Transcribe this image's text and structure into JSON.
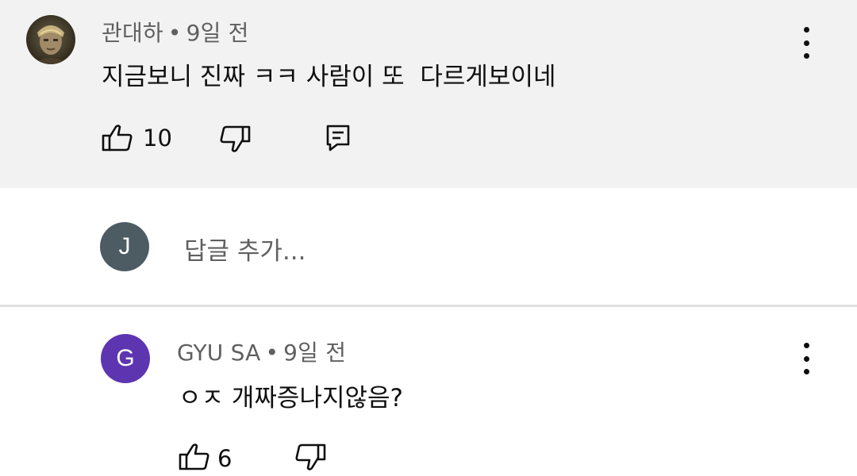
{
  "comment": {
    "author": "관대하",
    "separator": "•",
    "time": "9일 전",
    "text": "지금보니 진짜 ㅋㅋ 사람이 또  다르게보이네",
    "likes": "10"
  },
  "reply_box": {
    "avatar_letter": "J",
    "avatar_color": "#4d5b63",
    "placeholder": "답글 추가..."
  },
  "reply": {
    "avatar_letter": "G",
    "avatar_color": "#5e35b1",
    "author": "GYU SA",
    "separator": "•",
    "time": "9일 전",
    "text": "ㅇㅈ 개짜증나지않음?",
    "likes": "6"
  },
  "icons": {
    "like": "thumbs-up-icon",
    "dislike": "thumbs-down-icon",
    "reply": "comment-reply-icon",
    "more": "more-vertical-icon"
  }
}
